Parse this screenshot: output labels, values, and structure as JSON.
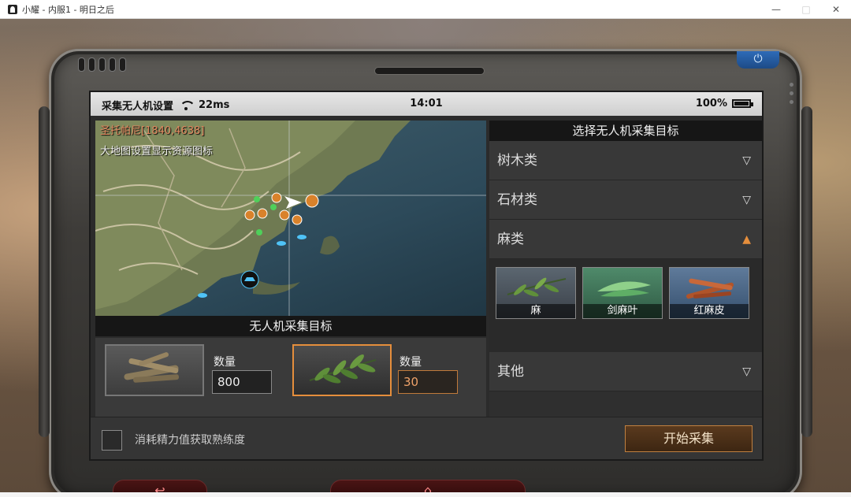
{
  "window": {
    "title": "小耀 - 内服1 - 明日之后",
    "minimize": "—",
    "maximize": "□",
    "close": "✕"
  },
  "status_bar": {
    "app_name": "采集无人机设置",
    "ping": "22ms",
    "time": "14:01",
    "battery": "100%"
  },
  "map": {
    "coordinates": "圣托帕尼[1840,4638]",
    "hint": "大地图设置显示资源图标"
  },
  "targets": {
    "title": "无人机采集目标",
    "slots": [
      {
        "item": "wood",
        "qty_label": "数量",
        "qty_value": "800"
      },
      {
        "item": "hemp",
        "qty_label": "数量",
        "qty_value": "30"
      }
    ]
  },
  "select_panel": {
    "title": "选择无人机采集目标",
    "categories": [
      {
        "label": "树木类",
        "expanded": false
      },
      {
        "label": "石材类",
        "expanded": false
      },
      {
        "label": "麻类",
        "expanded": true
      },
      {
        "label": "其他",
        "expanded": false
      }
    ],
    "hemp_items": [
      "麻",
      "剑麻叶",
      "红麻皮"
    ]
  },
  "footer": {
    "checkbox_label": "消耗精力值获取熟练度",
    "start_button": "开始采集"
  },
  "colors": {
    "accent": "#e58e3c",
    "power": "#2e6bb8",
    "nav": "#ff8b8b"
  },
  "icons": [
    "power-icon",
    "back-icon",
    "home-icon",
    "wifi-icon",
    "battery-icon",
    "chevron-down-icon",
    "chevron-up-icon"
  ]
}
